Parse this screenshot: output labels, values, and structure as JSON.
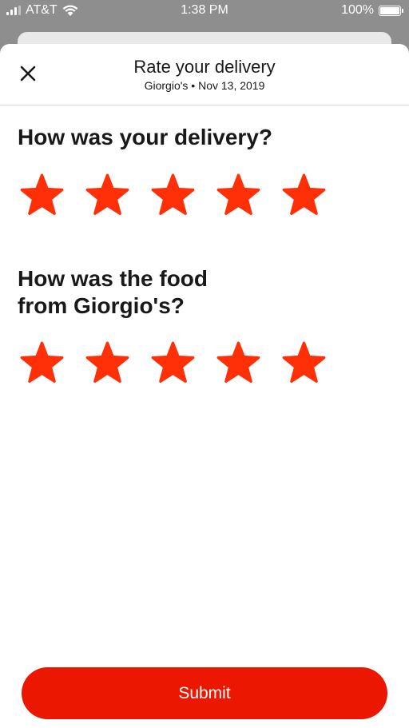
{
  "status_bar": {
    "carrier": "AT&T",
    "time": "1:38 PM",
    "battery": "100%"
  },
  "header": {
    "title": "Rate your delivery",
    "subtitle": "Giorgio's • Nov 13, 2019"
  },
  "questions": [
    {
      "text": "How was your delivery?",
      "rating": 5,
      "max": 5
    },
    {
      "text": "How was the food from Giorgio's?",
      "rating": 5,
      "max": 5
    }
  ],
  "submit_label": "Submit",
  "colors": {
    "accent": "#eb1700",
    "star": "#ff3008"
  },
  "icons": {
    "close": "close-icon",
    "star": "star-icon"
  }
}
